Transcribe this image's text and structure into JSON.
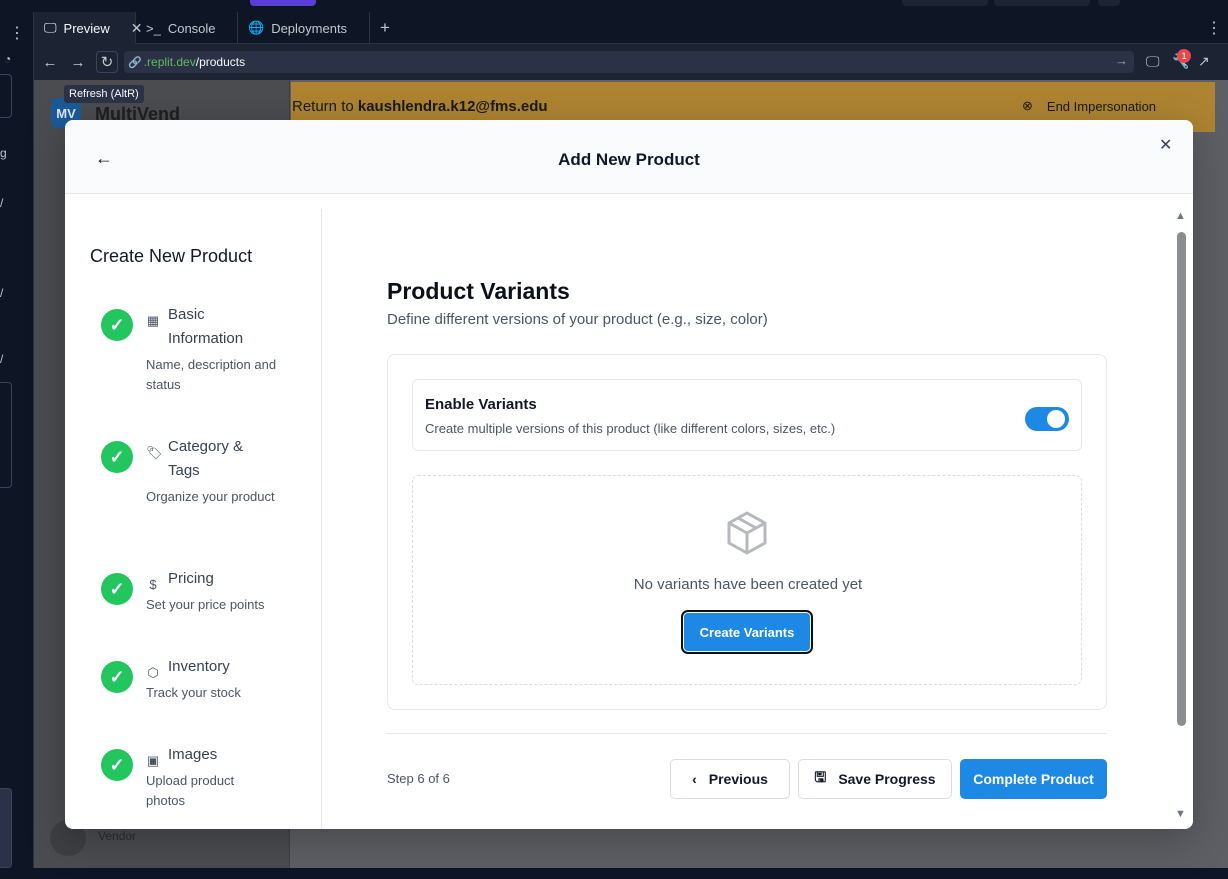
{
  "ide": {
    "tabs": [
      {
        "label": "Preview",
        "icon": "monitor-icon"
      },
      {
        "label": "Console",
        "icon": "terminal-icon"
      },
      {
        "label": "Deployments",
        "icon": "globe-icon"
      }
    ],
    "url_host": ".replit.dev",
    "url_path": "/products",
    "tooltip": "Refresh (AltR)",
    "notification_count": "1"
  },
  "app": {
    "logo": "MV",
    "brand": "MultiVend",
    "banner_prefix": "Return to ",
    "banner_user": "kaushlendra.k12@fms.edu",
    "end_impersonation": "End Impersonation",
    "vendor_label": "Vendor"
  },
  "modal": {
    "title": "Add New Product",
    "steps_title": "Create New Product",
    "steps": [
      {
        "name": "Basic Information",
        "desc": "Name, description and status",
        "icon": "grid-icon"
      },
      {
        "name": "Category & Tags",
        "desc": "Organize your product",
        "icon": "tag-icon"
      },
      {
        "name": "Pricing",
        "desc": "Set your price points",
        "icon": "dollar-icon"
      },
      {
        "name": "Inventory",
        "desc": "Track your stock",
        "icon": "box-icon"
      },
      {
        "name": "Images",
        "desc": "Upload product photos",
        "icon": "image-icon"
      }
    ],
    "section_title": "Product Variants",
    "section_sub": "Define different versions of your product (e.g., size, color)",
    "toggle_label": "Enable Variants",
    "toggle_desc": "Create multiple versions of this product (like different colors, sizes, etc.)",
    "toggle_on": true,
    "empty_text": "No variants have been created yet",
    "create_variants": "Create Variants",
    "step_count": "Step 6 of 6",
    "previous": "Previous",
    "save_progress": "Save Progress",
    "complete_product": "Complete Product"
  },
  "colors": {
    "accent": "#1e88e5",
    "success": "#22c55e",
    "banner": "#f0a30a"
  }
}
